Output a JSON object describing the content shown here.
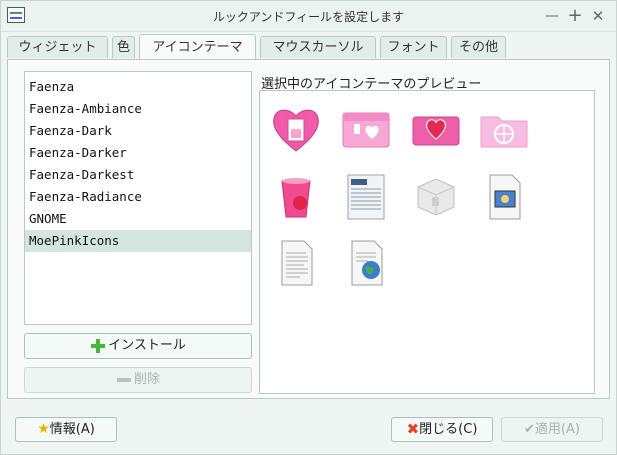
{
  "window": {
    "title": "ルックアンドフィールを設定します"
  },
  "tabs": [
    {
      "label": "ウィジェット"
    },
    {
      "label": "色"
    },
    {
      "label": "アイコンテーマ",
      "active": true
    },
    {
      "label": "マウスカーソル"
    },
    {
      "label": "フォント"
    },
    {
      "label": "その他"
    }
  ],
  "themes": {
    "items": [
      "Faenza",
      "Faenza-Ambiance",
      "Faenza-Dark",
      "Faenza-Darker",
      "Faenza-Darkest",
      "Faenza-Radiance",
      "GNOME",
      "MoePinkIcons"
    ],
    "selected": "MoePinkIcons"
  },
  "buttons": {
    "install": "インストール",
    "delete": "削除",
    "info": "情報(A)",
    "close": "閉じる(C)",
    "apply": "適用(A)"
  },
  "preview": {
    "title": "選択中のアイコンテーマのプレビュー"
  },
  "colors": {
    "accent_pink": "#f05aa8",
    "selection": "#d2e6df",
    "background": "#eef5f2"
  },
  "icons": [
    "heart-icon",
    "folder-pink-icon",
    "folder-heart-icon",
    "folder-network-icon",
    "trash-pink-icon",
    "document-newspaper-icon",
    "package-icon",
    "image-document-icon",
    "text-document-icon",
    "globe-document-icon"
  ]
}
